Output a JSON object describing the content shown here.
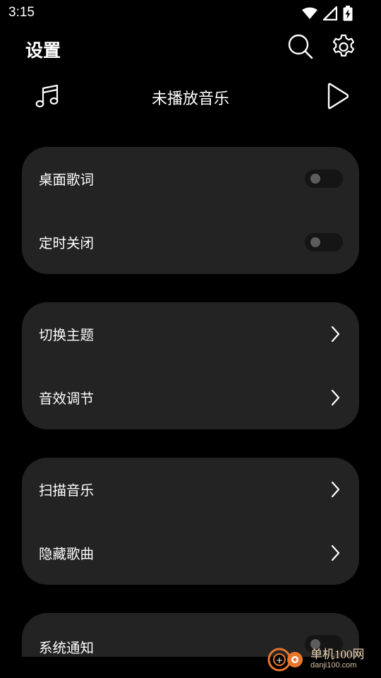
{
  "status_bar": {
    "time": "3:15",
    "icons": [
      "wifi-icon",
      "cellular-signal-icon",
      "battery-charging-icon"
    ]
  },
  "header": {
    "title": "设置",
    "search_icon": "search-icon",
    "settings_icon": "gear-icon"
  },
  "player": {
    "music_icon": "music-note-icon",
    "status_text": "未播放音乐",
    "play_icon": "play-icon"
  },
  "sections": [
    {
      "items": [
        {
          "label": "桌面歌词",
          "control": "toggle",
          "on": false
        },
        {
          "label": "定时关闭",
          "control": "toggle",
          "on": false
        }
      ]
    },
    {
      "items": [
        {
          "label": "切换主题",
          "control": "chevron"
        },
        {
          "label": "音效调节",
          "control": "chevron"
        }
      ]
    },
    {
      "items": [
        {
          "label": "扫描音乐",
          "control": "chevron"
        },
        {
          "label": "隐藏歌曲",
          "control": "chevron"
        }
      ]
    },
    {
      "items": [
        {
          "label": "系统通知",
          "control": "toggle",
          "on": false
        }
      ]
    }
  ],
  "watermark": {
    "main": "单机100网",
    "sub": "danji100.com"
  },
  "colors": {
    "background": "#000000",
    "card": "#232323",
    "text": "#ffffff",
    "toggle_track": "#151515",
    "toggle_knob": "#5c5c5c",
    "watermark": "#e8762c"
  }
}
